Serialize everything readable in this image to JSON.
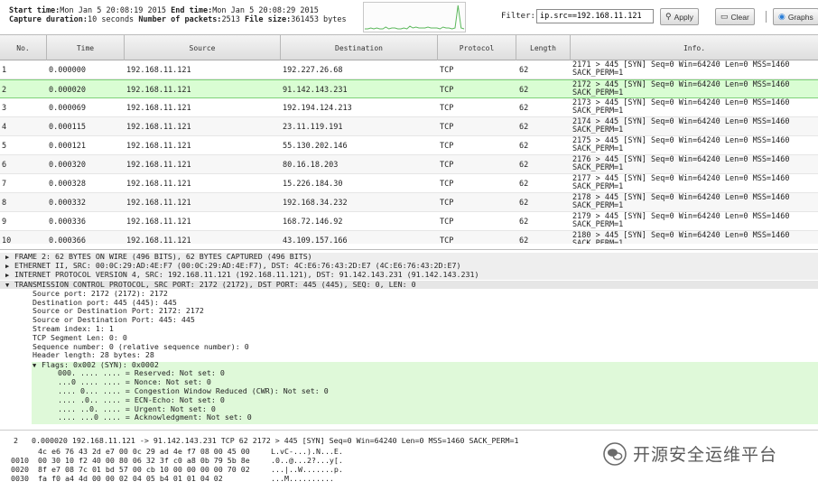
{
  "capture": {
    "start_label": "Start time:",
    "start_value": "Mon Jan 5 20:08:19 2015",
    "end_label": "End time:",
    "end_value": "Mon Jan 5 20:08:29 2015",
    "duration_label": "Capture duration:",
    "duration_value": "10 seconds",
    "packets_label": "Number of packets:",
    "packets_value": "2513",
    "size_label": "File size:",
    "size_value": "361453 bytes"
  },
  "sparkline": {
    "color": "#5cb85c",
    "values": [
      2,
      2,
      3,
      2,
      3,
      2,
      2,
      4,
      2,
      3,
      3,
      2,
      2,
      3,
      2,
      5,
      3,
      4,
      3,
      3,
      3,
      4,
      3,
      3,
      3,
      2,
      4,
      3,
      3,
      2,
      3,
      28,
      3,
      2
    ]
  },
  "toolbar": {
    "filter_label": "Filter:",
    "filter_value": "ip.src==192.168.11.121",
    "apply_label": "Apply",
    "clear_label": "Clear",
    "graphs_label": "Graphs"
  },
  "columns": [
    "No.",
    "Time",
    "Source",
    "Destination",
    "Protocol",
    "Length",
    "Info."
  ],
  "packets": [
    {
      "no": "1",
      "time": "0.000000",
      "src": "192.168.11.121",
      "dst": "192.227.26.68",
      "proto": "TCP",
      "len": "62",
      "info": "2171 > 445 [SYN] Seq=0 Win=64240 Len=0 MSS=1460\nSACK_PERM=1"
    },
    {
      "no": "2",
      "time": "0.000020",
      "src": "192.168.11.121",
      "dst": "91.142.143.231",
      "proto": "TCP",
      "len": "62",
      "info": "2172 > 445 [SYN] Seq=0 Win=64240 Len=0 MSS=1460\nSACK_PERM=1"
    },
    {
      "no": "3",
      "time": "0.000069",
      "src": "192.168.11.121",
      "dst": "192.194.124.213",
      "proto": "TCP",
      "len": "62",
      "info": "2173 > 445 [SYN] Seq=0 Win=64240 Len=0 MSS=1460\nSACK_PERM=1"
    },
    {
      "no": "4",
      "time": "0.000115",
      "src": "192.168.11.121",
      "dst": "23.11.119.191",
      "proto": "TCP",
      "len": "62",
      "info": "2174 > 445 [SYN] Seq=0 Win=64240 Len=0 MSS=1460\nSACK_PERM=1"
    },
    {
      "no": "5",
      "time": "0.000121",
      "src": "192.168.11.121",
      "dst": "55.130.202.146",
      "proto": "TCP",
      "len": "62",
      "info": "2175 > 445 [SYN] Seq=0 Win=64240 Len=0 MSS=1460\nSACK_PERM=1"
    },
    {
      "no": "6",
      "time": "0.000320",
      "src": "192.168.11.121",
      "dst": "80.16.18.203",
      "proto": "TCP",
      "len": "62",
      "info": "2176 > 445 [SYN] Seq=0 Win=64240 Len=0 MSS=1460\nSACK_PERM=1"
    },
    {
      "no": "7",
      "time": "0.000328",
      "src": "192.168.11.121",
      "dst": "15.226.184.30",
      "proto": "TCP",
      "len": "62",
      "info": "2177 > 445 [SYN] Seq=0 Win=64240 Len=0 MSS=1460\nSACK_PERM=1"
    },
    {
      "no": "8",
      "time": "0.000332",
      "src": "192.168.11.121",
      "dst": "192.168.34.232",
      "proto": "TCP",
      "len": "62",
      "info": "2178 > 445 [SYN] Seq=0 Win=64240 Len=0 MSS=1460\nSACK_PERM=1"
    },
    {
      "no": "9",
      "time": "0.000336",
      "src": "192.168.11.121",
      "dst": "168.72.146.92",
      "proto": "TCP",
      "len": "62",
      "info": "2179 > 445 [SYN] Seq=0 Win=64240 Len=0 MSS=1460\nSACK_PERM=1"
    },
    {
      "no": "10",
      "time": "0.000366",
      "src": "192.168.11.121",
      "dst": "43.109.157.166",
      "proto": "TCP",
      "len": "62",
      "info": "2180 > 445 [SYN] Seq=0 Win=64240 Len=0 MSS=1460\nSACK_PERM=1"
    }
  ],
  "selected_row": "2",
  "details": [
    {
      "depth": 0,
      "toggle": "▶",
      "text": "FRAME 2: 62 BYTES ON WIRE (496 BITS), 62 BYTES CAPTURED (496 BITS)"
    },
    {
      "depth": 0,
      "toggle": "▶",
      "text": "ETHERNET II, SRC: 00:0C:29:AD:4E:F7 (00:0C:29:AD:4E:F7), DST: 4C:E6:76:43:2D:E7 (4C:E6:76:43:2D:E7)"
    },
    {
      "depth": 0,
      "toggle": "▶",
      "text": "INTERNET PROTOCOL VERSION 4, SRC: 192.168.11.121 (192.168.11.121), DST: 91.142.143.231 (91.142.143.231)"
    },
    {
      "depth": 0,
      "toggle": "▼",
      "text": "TRANSMISSION CONTROL PROTOCOL, SRC PORT: 2172 (2172), DST PORT: 445 (445), SEQ: 0, LEN: 0"
    },
    {
      "depth": 1,
      "toggle": "",
      "text": "Source port: 2172 (2172): 2172"
    },
    {
      "depth": 1,
      "toggle": "",
      "text": "Destination port: 445 (445): 445"
    },
    {
      "depth": 1,
      "toggle": "",
      "text": "Source or Destination Port: 2172: 2172"
    },
    {
      "depth": 1,
      "toggle": "",
      "text": "Source or Destination Port: 445: 445"
    },
    {
      "depth": 1,
      "toggle": "",
      "text": "Stream index: 1: 1"
    },
    {
      "depth": 1,
      "toggle": "",
      "text": "TCP Segment Len: 0: 0"
    },
    {
      "depth": 1,
      "toggle": "",
      "text": "Sequence number: 0 (relative sequence number): 0"
    },
    {
      "depth": 1,
      "toggle": "",
      "text": "Header length: 28 bytes: 28"
    },
    {
      "depth": 1,
      "toggle": "▼",
      "text": "Flags: 0x002 (SYN): 0x0002"
    },
    {
      "depth": 2,
      "toggle": "",
      "text": "000. .... .... = Reserved: Not set: 0"
    },
    {
      "depth": 2,
      "toggle": "",
      "text": "...0 .... .... = Nonce: Not set: 0"
    },
    {
      "depth": 2,
      "toggle": "",
      "text": ".... 0... .... = Congestion Window Reduced (CWR): Not set: 0"
    },
    {
      "depth": 2,
      "toggle": "",
      "text": ".... .0.. .... = ECN-Echo: Not set: 0"
    },
    {
      "depth": 2,
      "toggle": "",
      "text": ".... ..0. .... = Urgent: Not set: 0"
    },
    {
      "depth": 2,
      "toggle": "",
      "text": ".... ...0 .... = Acknowledgment: Not set: 0"
    }
  ],
  "hex": {
    "summary": "   2   0.000020 192.168.11.121 -> 91.142.143.231 TCP 62 2172 > 445 [SYN] Seq=0 Win=64240 Len=0 MSS=1460 SACK_PERM=1",
    "lines": [
      {
        "offset": "    ",
        "bytes": "4c e6 76 43 2d e7 00 0c 29 ad 4e f7 08 00 45 00",
        "ascii": "L.vC-...).N...E."
      },
      {
        "offset": "0010",
        "bytes": "00 30 10 f2 40 00 80 06 32 3f c0 a8 0b 79 5b 8e",
        "ascii": ".0..@...2?...y[."
      },
      {
        "offset": "0020",
        "bytes": "8f e7 08 7c 01 bd 57 00 cb 10 00 00 00 00 70 02",
        "ascii": "...|..W.......p."
      },
      {
        "offset": "0030",
        "bytes": "fa f0 a4 4d 00 00 02 04 05 b4 01 01 04 02      ",
        "ascii": "...M.........."
      }
    ]
  },
  "watermark": "开源安全运维平台"
}
